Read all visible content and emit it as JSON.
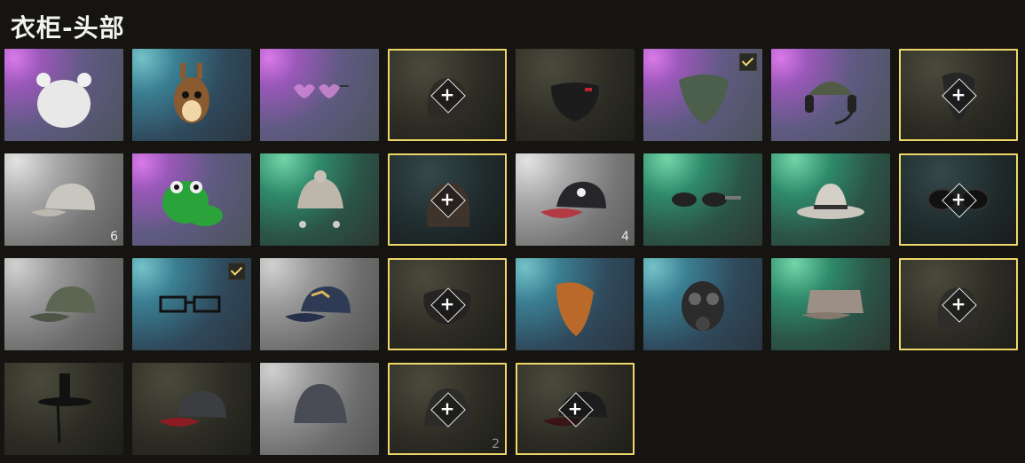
{
  "title": "衣柜-头部",
  "colors": {
    "selected_border": "#f0d76a",
    "check": "#f0d76a"
  },
  "slots": [
    {
      "item": "white-bear-beanie",
      "rarity": "purple"
    },
    {
      "item": "squirrel-mask",
      "rarity": "blue"
    },
    {
      "item": "heart-sunglasses",
      "rarity": "purple"
    },
    {
      "item": "dark-helmet",
      "rarity": "dark",
      "selected": true,
      "equip_slot": true
    },
    {
      "item": "black-face-mask",
      "rarity": "dark"
    },
    {
      "item": "camo-bandana",
      "rarity": "purple",
      "equipped": true
    },
    {
      "item": "headset-cap",
      "rarity": "purple"
    },
    {
      "item": "dark-bandana",
      "rarity": "dark",
      "selected": true,
      "equip_slot": true
    },
    {
      "item": "grey-baseball-cap",
      "rarity": "grey",
      "count": "6"
    },
    {
      "item": "green-dinosaur-mask",
      "rarity": "purple"
    },
    {
      "item": "knit-earflap-hat",
      "rarity": "green"
    },
    {
      "item": "leather-aviator-mask",
      "rarity": "darkteal",
      "selected": true,
      "equip_slot": true
    },
    {
      "item": "black-red-cap",
      "rarity": "grey",
      "count": "4"
    },
    {
      "item": "camo-sunglasses",
      "rarity": "green"
    },
    {
      "item": "white-fedora",
      "rarity": "green"
    },
    {
      "item": "black-sunglasses",
      "rarity": "darkteal",
      "selected": true,
      "equip_slot": true
    },
    {
      "item": "green-camo-cap",
      "rarity": "gray2"
    },
    {
      "item": "rectangular-glasses",
      "rarity": "blue",
      "equipped": true
    },
    {
      "item": "denim-cap",
      "rarity": "gray2"
    },
    {
      "item": "black-scarf",
      "rarity": "dark",
      "selected": true,
      "equip_slot": true
    },
    {
      "item": "plaid-bandana",
      "rarity": "blue"
    },
    {
      "item": "gas-mask",
      "rarity": "blue"
    },
    {
      "item": "patrol-cap",
      "rarity": "green"
    },
    {
      "item": "dark-balaclava",
      "rarity": "dark",
      "selected": true,
      "equip_slot": true
    },
    {
      "item": "gat-hat",
      "rarity": "dark"
    },
    {
      "item": "dark-grey-cap",
      "rarity": "dark"
    },
    {
      "item": "grey-beanie",
      "rarity": "gray2"
    },
    {
      "item": "dark-beanie",
      "rarity": "dark",
      "selected": true,
      "equip_slot": true,
      "count": "2",
      "count_dim": true
    },
    {
      "item": "black-cap-red",
      "rarity": "dark",
      "selected": true,
      "equip_slot": true
    }
  ],
  "plus_symbol": "+"
}
